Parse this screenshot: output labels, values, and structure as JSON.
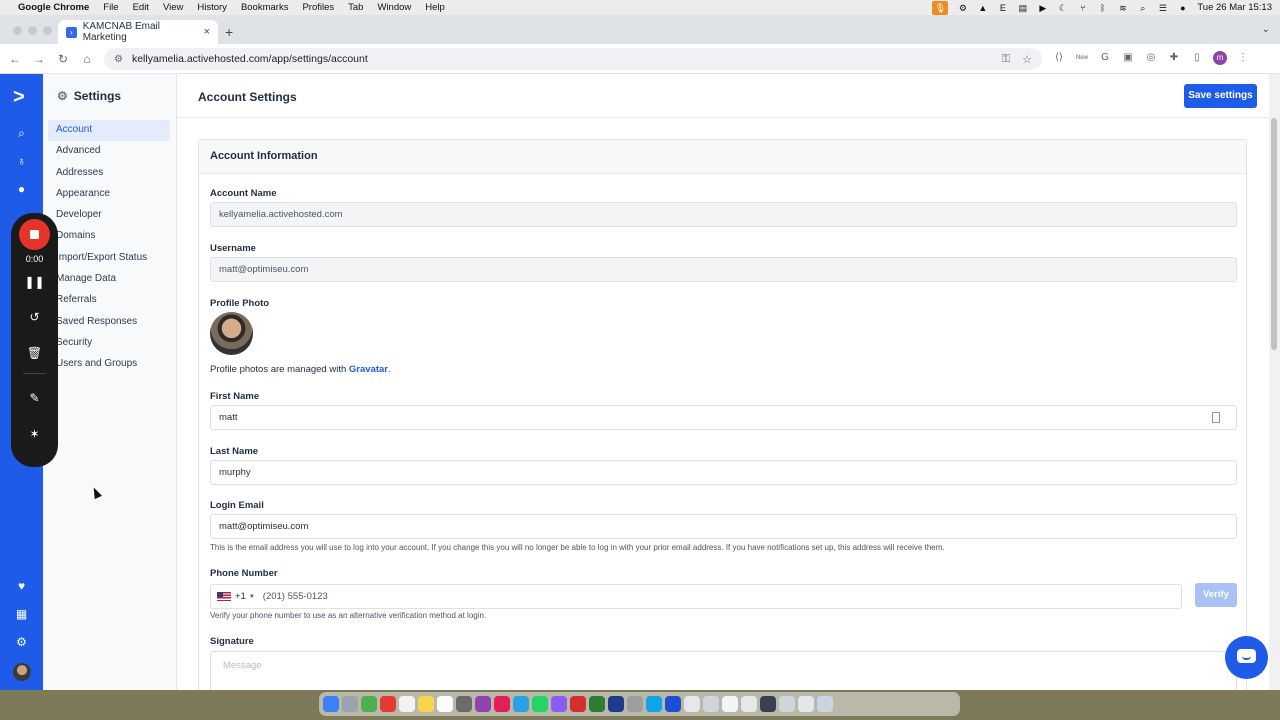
{
  "menubar": {
    "app": "Google Chrome",
    "items": [
      "File",
      "Edit",
      "View",
      "History",
      "Bookmarks",
      "Profiles",
      "Tab",
      "Window",
      "Help"
    ],
    "clock": "Tue 26 Mar  15:13"
  },
  "browser": {
    "tab_title": "KAMCNAB Email Marketing",
    "url": "kellyamelia.activehosted.com/app/settings/account",
    "ext_new_label": "New",
    "profile_initial": "m"
  },
  "settings_nav": {
    "heading": "Settings",
    "items": [
      {
        "label": "Account",
        "active": true
      },
      {
        "label": "Advanced"
      },
      {
        "label": "Addresses"
      },
      {
        "label": "Appearance"
      },
      {
        "label": "Developer"
      },
      {
        "label": "Domains"
      },
      {
        "label": "Import/Export Status"
      },
      {
        "label": "Manage Data"
      },
      {
        "label": "Referrals"
      },
      {
        "label": "Saved Responses"
      },
      {
        "label": "Security"
      },
      {
        "label": "Users and Groups"
      }
    ]
  },
  "recorder": {
    "time": "0:00"
  },
  "page": {
    "title": "Account Settings",
    "save_label": "Save settings",
    "card_title": "Account Information",
    "account_name_label": "Account Name",
    "account_name_value": "kellyamelia.activehosted.com",
    "username_label": "Username",
    "username_value": "matt@optimiseu.com",
    "profile_photo_label": "Profile Photo",
    "photo_note_prefix": "Profile photos are managed with ",
    "photo_note_link": "Gravatar",
    "photo_note_suffix": ".",
    "first_name_label": "First Name",
    "first_name_value": "matt",
    "last_name_label": "Last Name",
    "last_name_value": "murphy",
    "login_email_label": "Login Email",
    "login_email_value": "matt@optimiseu.com",
    "login_email_help": "This is the email address you will use to log into your account. If you change this you will no longer be able to log in with your prior email address. If you have notifications set up, this address will receive them.",
    "phone_label": "Phone Number",
    "phone_country_code": "+1",
    "phone_placeholder": "(201) 555-0123",
    "verify_label": "Verify",
    "phone_help": "Verify your phone number to use as an alternative verification method at login.",
    "signature_label": "Signature",
    "signature_placeholder": "Message"
  }
}
